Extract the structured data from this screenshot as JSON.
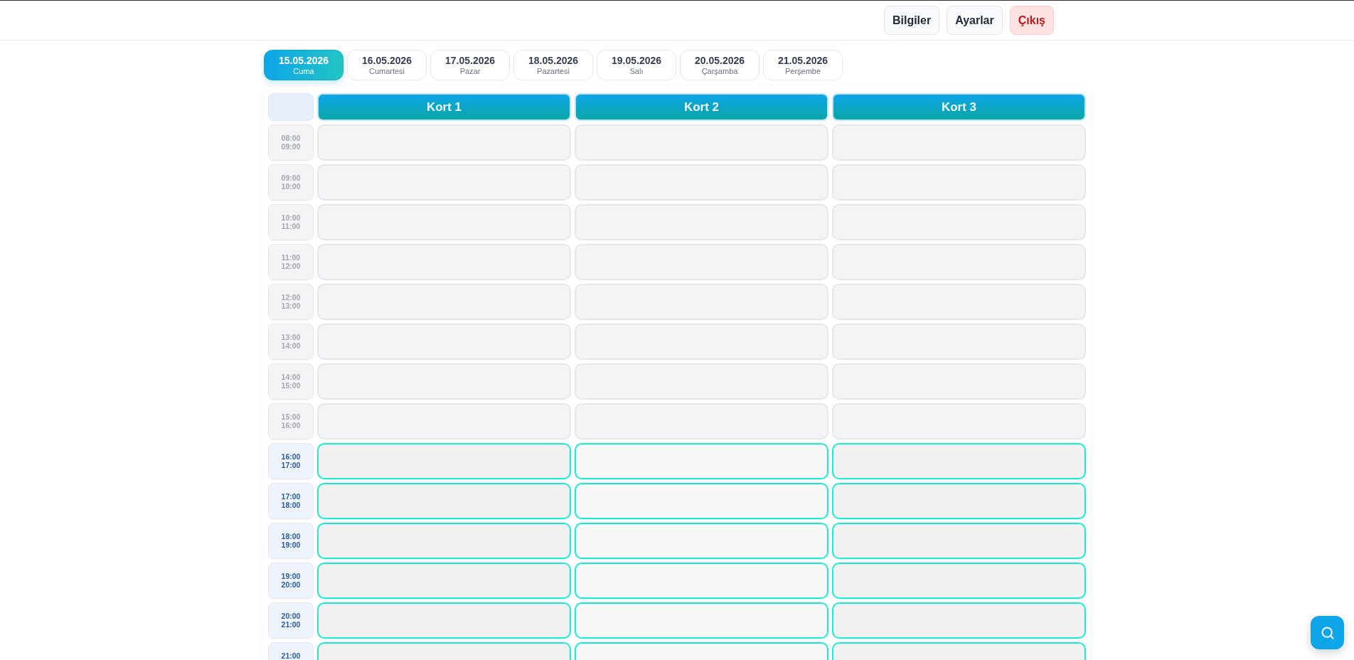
{
  "top_bar": {
    "buttons": [
      {
        "label": "Bilgiler",
        "kind": "plain"
      },
      {
        "label": "Ayarlar",
        "kind": "plain"
      },
      {
        "label": "Çıkış",
        "kind": "danger"
      }
    ]
  },
  "date_tabs": [
    {
      "date": "15.05.2026",
      "day": "Cuma",
      "selected": true
    },
    {
      "date": "16.05.2026",
      "day": "Cumartesi",
      "selected": false
    },
    {
      "date": "17.05.2026",
      "day": "Pazar",
      "selected": false
    },
    {
      "date": "18.05.2026",
      "day": "Pazartesi",
      "selected": false
    },
    {
      "date": "19.05.2026",
      "day": "Salı",
      "selected": false
    },
    {
      "date": "20.05.2026",
      "day": "Çarşamba",
      "selected": false
    },
    {
      "date": "21.05.2026",
      "day": "Perşembe",
      "selected": false
    }
  ],
  "schedule": {
    "courts": [
      {
        "name": "Kort 1"
      },
      {
        "name": "Kort 2"
      },
      {
        "name": "Kort 3"
      }
    ],
    "rows": [
      {
        "start": "08:00",
        "end": "09:00",
        "available": false
      },
      {
        "start": "09:00",
        "end": "10:00",
        "available": false
      },
      {
        "start": "10:00",
        "end": "11:00",
        "available": false
      },
      {
        "start": "11:00",
        "end": "12:00",
        "available": false
      },
      {
        "start": "12:00",
        "end": "13:00",
        "available": false
      },
      {
        "start": "13:00",
        "end": "14:00",
        "available": false
      },
      {
        "start": "14:00",
        "end": "15:00",
        "available": false
      },
      {
        "start": "15:00",
        "end": "16:00",
        "available": false
      },
      {
        "start": "16:00",
        "end": "17:00",
        "available": true
      },
      {
        "start": "17:00",
        "end": "18:00",
        "available": true
      },
      {
        "start": "18:00",
        "end": "19:00",
        "available": true
      },
      {
        "start": "19:00",
        "end": "20:00",
        "available": true
      },
      {
        "start": "20:00",
        "end": "21:00",
        "available": true
      },
      {
        "start": "21:00",
        "available": true
      }
    ]
  }
}
